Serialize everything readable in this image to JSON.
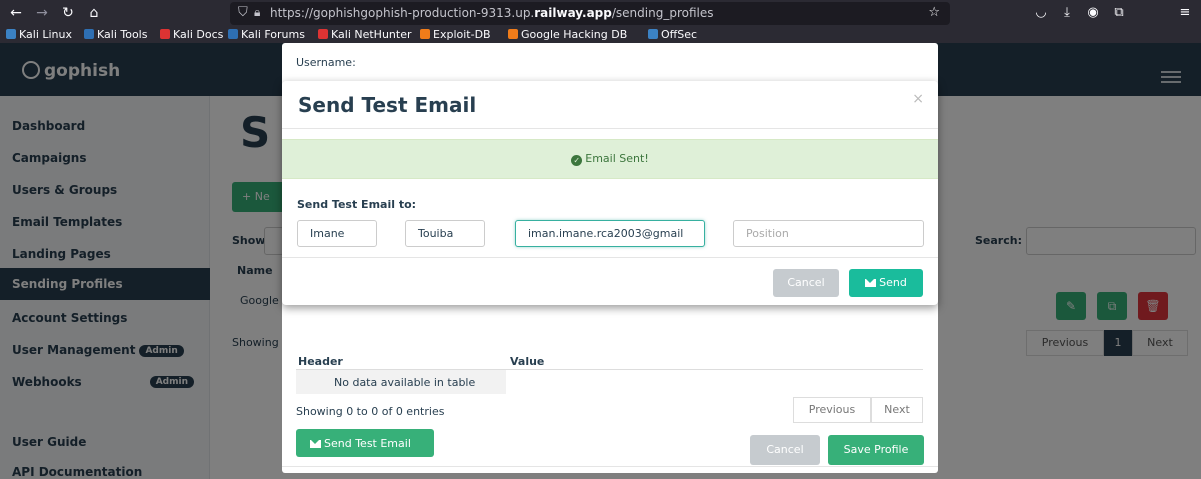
{
  "browser": {
    "url_prefix": "https://gophishgophish-production-9313.up.",
    "url_domain": "railway.app",
    "url_suffix": "/sending_profiles",
    "bookmarks": [
      {
        "label": "Kali Linux",
        "color": "#3b82c4"
      },
      {
        "label": "Kali Tools",
        "color": "#2e6fb3"
      },
      {
        "label": "Kali Docs",
        "color": "#d33"
      },
      {
        "label": "Kali Forums",
        "color": "#2e6fb3"
      },
      {
        "label": "Kali NetHunter",
        "color": "#d33"
      },
      {
        "label": "Exploit-DB",
        "color": "#f07c1a"
      },
      {
        "label": "Google Hacking DB",
        "color": "#f07c1a"
      },
      {
        "label": "OffSec",
        "color": "#3b82c4"
      }
    ]
  },
  "app": {
    "brand": "gophish"
  },
  "sidebar": {
    "items": [
      {
        "label": "Dashboard"
      },
      {
        "label": "Campaigns"
      },
      {
        "label": "Users & Groups"
      },
      {
        "label": "Email Templates"
      },
      {
        "label": "Landing Pages"
      },
      {
        "label": "Sending Profiles"
      },
      {
        "label": "Account Settings"
      },
      {
        "label": "User Management"
      },
      {
        "label": "Webhooks"
      },
      {
        "label": "User Guide"
      },
      {
        "label": "API Documentation"
      }
    ],
    "admin_badge": "Admin"
  },
  "page": {
    "title_fragment": "S",
    "new_button": "+ Ne",
    "show_label": "Show",
    "search_label": "Search:",
    "name_header": "Name",
    "row_fragment": "Google",
    "showing_fragment": "Showing",
    "pager_prev": "Previous",
    "pager_page": "1",
    "pager_next": "Next"
  },
  "under_modal": {
    "username_label": "Username:",
    "header_col": "Header",
    "value_col": "Value",
    "empty_text": "No data available in table",
    "showing_text": "Showing 0 to 0 of 0 entries",
    "prev": "Previous",
    "next": "Next",
    "send_test_button": "Send Test Email",
    "cancel_button": "Cancel",
    "save_button": "Save Profile"
  },
  "modal": {
    "title": "Send Test Email",
    "close": "×",
    "alert": "Email Sent!",
    "send_to_label": "Send Test Email to:",
    "first_name": "Imane",
    "last_name": "Touiba",
    "email": "iman.imane.rca2003@gmail",
    "position_placeholder": "Position",
    "cancel_button": "Cancel",
    "send_button": "Send"
  },
  "colors": {
    "navy": "#283f50",
    "green": "#37b079",
    "teal": "#1abc9c",
    "success_bg": "#dff0d8",
    "danger": "#e0343d"
  }
}
